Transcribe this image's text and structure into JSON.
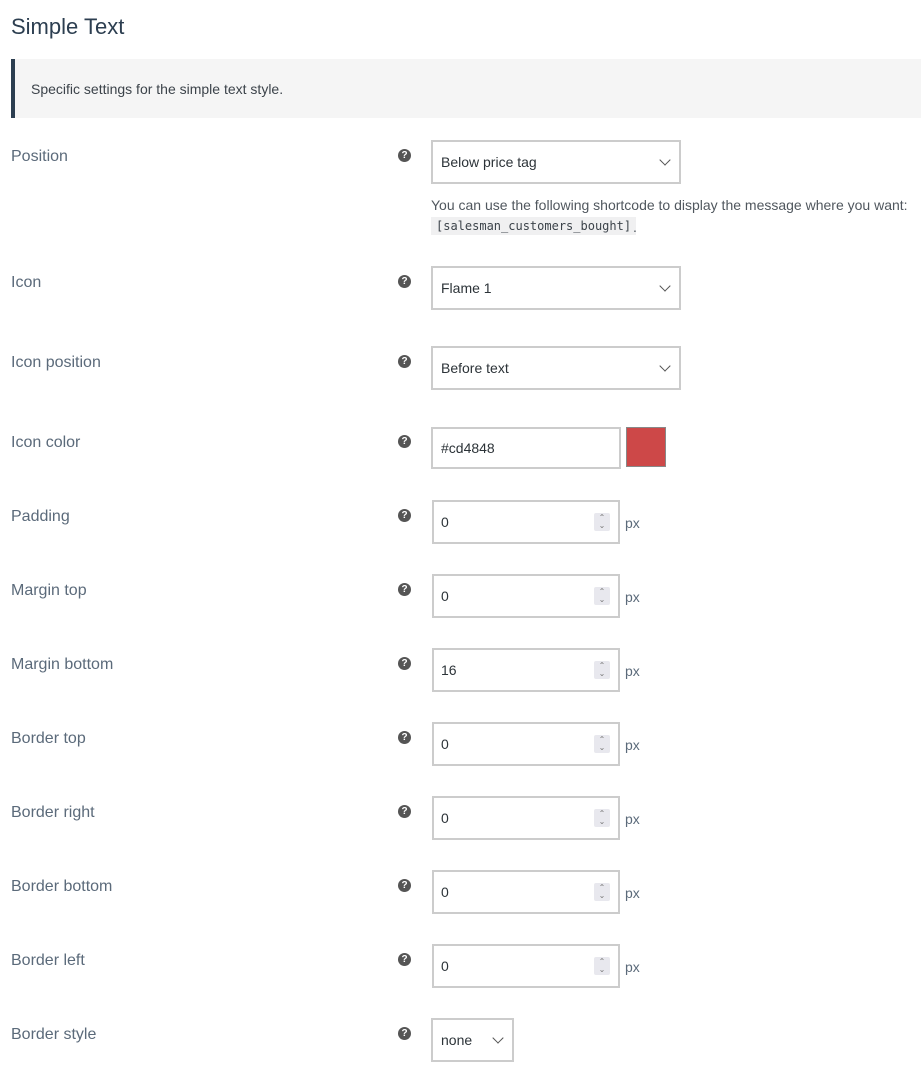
{
  "title": "Simple Text",
  "notice": "Specific settings for the simple text style.",
  "help_glyph": "?",
  "spin_glyph": "⌃⌄",
  "fields": {
    "position": {
      "label": "Position",
      "value": "Below price tag",
      "description": "You can use the following shortcode to display the message where you want:",
      "shortcode": "[salesman_customers_bought]",
      "shortcode_suffix": "."
    },
    "icon": {
      "label": "Icon",
      "value": "Flame 1"
    },
    "icon_position": {
      "label": "Icon position",
      "value": "Before text"
    },
    "icon_color": {
      "label": "Icon color",
      "value": "#cd4848",
      "swatch": "#cd4848"
    },
    "padding": {
      "label": "Padding",
      "value": "0",
      "unit": "px"
    },
    "margin_top": {
      "label": "Margin top",
      "value": "0",
      "unit": "px"
    },
    "margin_bottom": {
      "label": "Margin bottom",
      "value": "16",
      "unit": "px"
    },
    "border_top": {
      "label": "Border top",
      "value": "0",
      "unit": "px"
    },
    "border_right": {
      "label": "Border right",
      "value": "0",
      "unit": "px"
    },
    "border_bottom": {
      "label": "Border bottom",
      "value": "0",
      "unit": "px"
    },
    "border_left": {
      "label": "Border left",
      "value": "0",
      "unit": "px"
    },
    "border_style": {
      "label": "Border style",
      "value": "none"
    }
  }
}
